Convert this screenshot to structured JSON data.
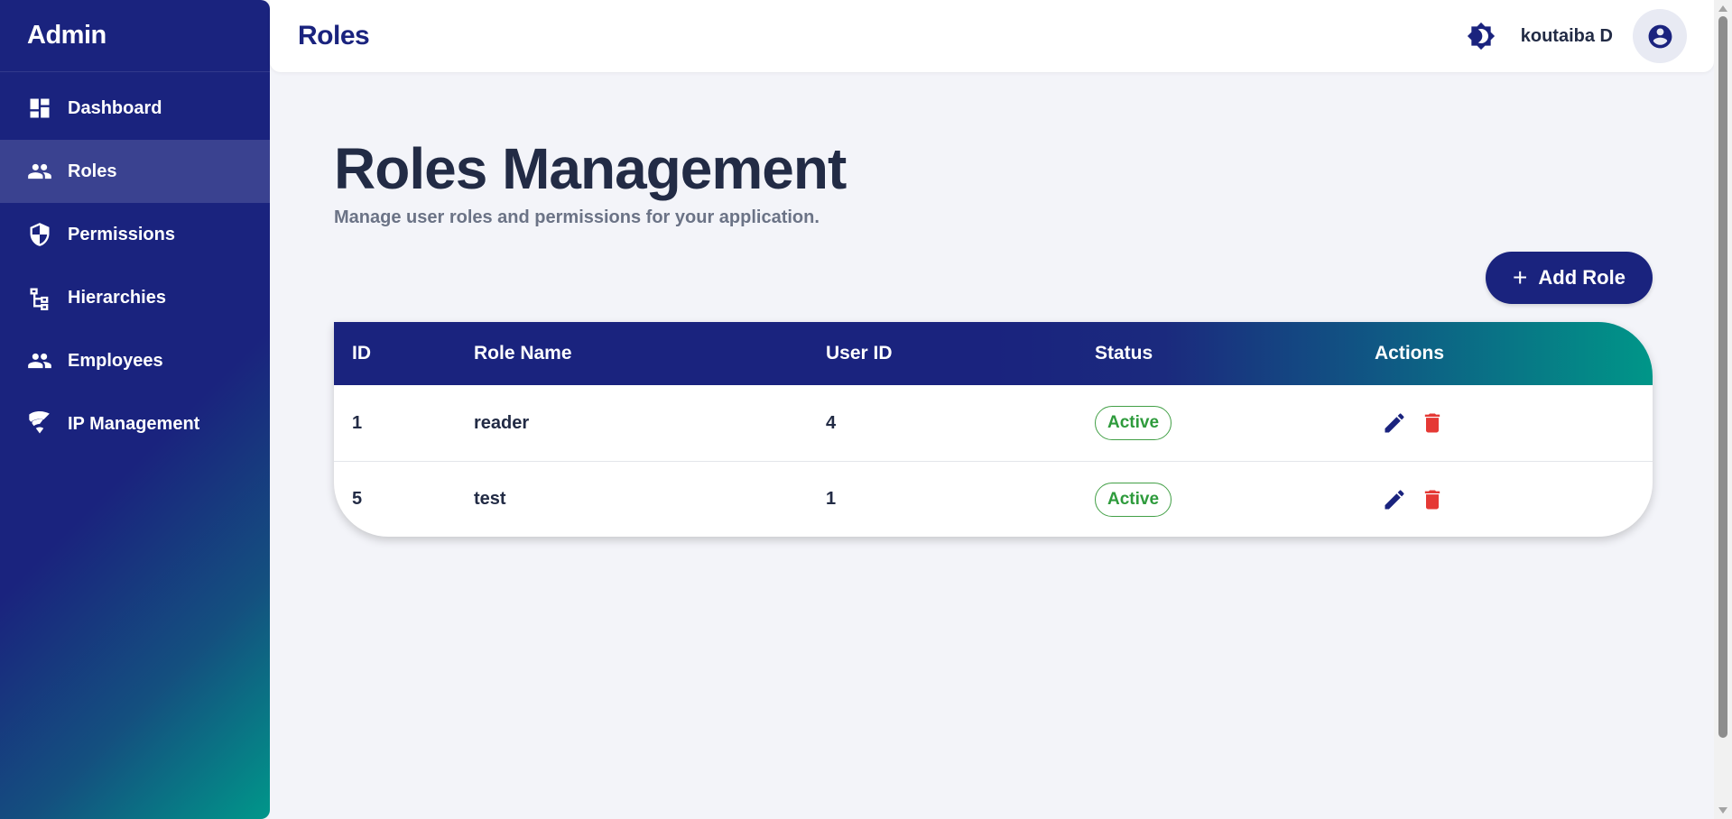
{
  "sidebar": {
    "brand": "Admin",
    "items": [
      {
        "label": "Dashboard",
        "icon": "dashboard-icon"
      },
      {
        "label": "Roles",
        "icon": "people-icon",
        "active": true
      },
      {
        "label": "Permissions",
        "icon": "shield-icon"
      },
      {
        "label": "Hierarchies",
        "icon": "hierarchy-icon"
      },
      {
        "label": "Employees",
        "icon": "people-icon"
      },
      {
        "label": "IP Management",
        "icon": "network-icon"
      }
    ]
  },
  "header": {
    "title": "Roles",
    "username": "koutaiba D",
    "theme_icon": "brightness-icon",
    "avatar_icon": "account-circle-icon"
  },
  "main": {
    "title": "Roles Management",
    "subtitle": "Manage user roles and permissions for your application.",
    "add_button": {
      "icon": "plus-icon",
      "label": "Add Role"
    },
    "table": {
      "columns": [
        "ID",
        "Role Name",
        "User ID",
        "Status",
        "Actions"
      ],
      "rows": [
        {
          "id": "1",
          "role_name": "reader",
          "user_id": "4",
          "status": "Active"
        },
        {
          "id": "5",
          "role_name": "test",
          "user_id": "1",
          "status": "Active"
        }
      ]
    }
  },
  "colors": {
    "primary": "#1a237e",
    "accent": "#009688",
    "active_status": "#2e9b3c",
    "delete": "#e53935",
    "background": "#f3f4f9"
  }
}
